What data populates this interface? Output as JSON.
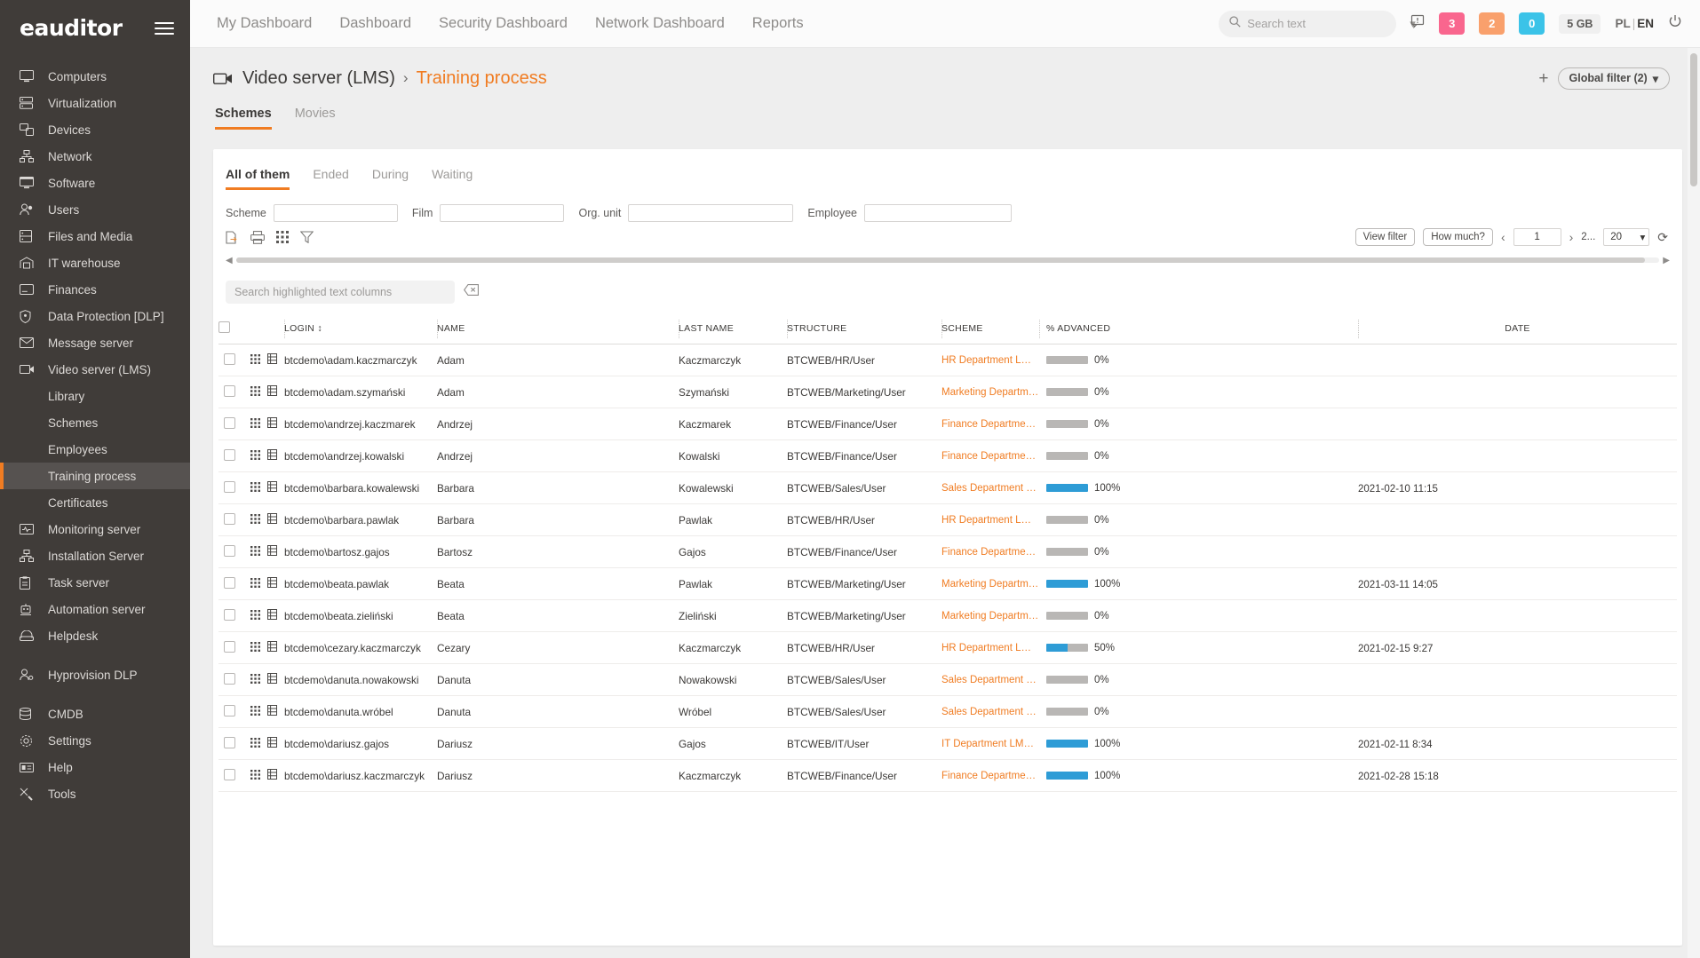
{
  "brand": {
    "logo": "eauditor"
  },
  "sidebar": {
    "items": [
      {
        "label": "Computers",
        "icon": "monitor-icon"
      },
      {
        "label": "Virtualization",
        "icon": "server-stack-icon"
      },
      {
        "label": "Devices",
        "icon": "devices-icon"
      },
      {
        "label": "Network",
        "icon": "network-icon"
      },
      {
        "label": "Software",
        "icon": "monitor-icon"
      },
      {
        "label": "Users",
        "icon": "users-icon"
      },
      {
        "label": "Files and Media",
        "icon": "files-icon"
      },
      {
        "label": "IT warehouse",
        "icon": "warehouse-icon"
      },
      {
        "label": "Finances",
        "icon": "card-icon"
      },
      {
        "label": "Data Protection [DLP]",
        "icon": "shield-icon"
      },
      {
        "label": "Message server",
        "icon": "envelope-icon"
      },
      {
        "label": "Video server (LMS)",
        "icon": "video-camera-icon"
      }
    ],
    "subitems": [
      {
        "label": "Library",
        "active": false
      },
      {
        "label": "Schemes",
        "active": false
      },
      {
        "label": "Employees",
        "active": false
      },
      {
        "label": "Training process",
        "active": true
      },
      {
        "label": "Certificates",
        "active": false
      }
    ],
    "items2": [
      {
        "label": "Monitoring server",
        "icon": "monitor-pulse-icon"
      },
      {
        "label": "Installation Server",
        "icon": "network-icon"
      },
      {
        "label": "Task server",
        "icon": "clipboard-icon"
      },
      {
        "label": "Automation server",
        "icon": "robot-icon"
      },
      {
        "label": "Helpdesk",
        "icon": "helpdesk-icon"
      }
    ],
    "items3": [
      {
        "label": "Hyprovision DLP",
        "icon": "user-lock-icon"
      }
    ],
    "items4": [
      {
        "label": "CMDB",
        "icon": "database-icon"
      },
      {
        "label": "Settings",
        "icon": "gear-icon"
      },
      {
        "label": "Help",
        "icon": "help-card-icon"
      },
      {
        "label": "Tools",
        "icon": "tools-icon"
      }
    ]
  },
  "topbar": {
    "nav": [
      {
        "label": "My Dashboard"
      },
      {
        "label": "Dashboard"
      },
      {
        "label": "Security Dashboard"
      },
      {
        "label": "Network Dashboard"
      },
      {
        "label": "Reports"
      }
    ],
    "search_placeholder": "Search text",
    "search_value": "",
    "badges": [
      {
        "value": "3",
        "color": "#f9668e"
      },
      {
        "value": "2",
        "color": "#f9a06c"
      },
      {
        "value": "0",
        "color": "#3bc3e8"
      }
    ],
    "storage": "5 GB",
    "lang_left": "PL",
    "lang_sep": "|",
    "lang_right": "EN"
  },
  "breadcrumb": {
    "parent": "Video server (LMS)",
    "separator": "›",
    "current": "Training process"
  },
  "global_filter": {
    "plus": "+",
    "label": "Global filter (2)",
    "chevron": "⌄"
  },
  "tabs_primary": [
    {
      "label": "Schemes",
      "active": true
    },
    {
      "label": "Movies",
      "active": false
    }
  ],
  "tabs_secondary": [
    {
      "label": "All of them",
      "active": true
    },
    {
      "label": "Ended",
      "active": false
    },
    {
      "label": "During",
      "active": false
    },
    {
      "label": "Waiting",
      "active": false
    }
  ],
  "filters": [
    {
      "label": "Scheme",
      "value": ""
    },
    {
      "label": "Film",
      "value": ""
    },
    {
      "label": "Org. unit",
      "value": ""
    },
    {
      "label": "Employee",
      "value": ""
    }
  ],
  "toolbar": {
    "icons": [
      {
        "name": "export-icon"
      },
      {
        "name": "print-icon"
      },
      {
        "name": "grid-icon"
      },
      {
        "name": "filter-icon"
      }
    ],
    "view_filter_label": "View filter",
    "how_much_label": "How much?",
    "prev": "‹",
    "page_value": "1",
    "next": "›",
    "total_pages": "2...",
    "page_size": "20",
    "refresh": "⟳"
  },
  "highlight_search": {
    "placeholder": "Search highlighted text columns",
    "value": "",
    "clear_icon": "clear-icon"
  },
  "table": {
    "columns": [
      "LOGIN",
      "NAME",
      "LAST NAME",
      "STRUCTURE",
      "SCHEME",
      "% ADVANCED",
      "DATE"
    ],
    "sort_column": "LOGIN",
    "sort_glyph": "↕",
    "rows": [
      {
        "login": "btcdemo\\adam.kaczmarczyk",
        "name": "Adam",
        "last_name": "Kaczmarczyk",
        "structure": "BTCWEB/HR/User",
        "scheme": "HR Department LMS Scheme",
        "percent": 0,
        "percent_label": "0%",
        "date": ""
      },
      {
        "login": "btcdemo\\adam.szymański",
        "name": "Adam",
        "last_name": "Szymański",
        "structure": "BTCWEB/Marketing/User",
        "scheme": "Marketing Department LMS Sche…",
        "percent": 0,
        "percent_label": "0%",
        "date": ""
      },
      {
        "login": "btcdemo\\andrzej.kaczmarek",
        "name": "Andrzej",
        "last_name": "Kaczmarek",
        "structure": "BTCWEB/Finance/User",
        "scheme": "Finance Department LMS Scheme",
        "percent": 0,
        "percent_label": "0%",
        "date": ""
      },
      {
        "login": "btcdemo\\andrzej.kowalski",
        "name": "Andrzej",
        "last_name": "Kowalski",
        "structure": "BTCWEB/Finance/User",
        "scheme": "Finance Department LMS Scheme",
        "percent": 0,
        "percent_label": "0%",
        "date": ""
      },
      {
        "login": "btcdemo\\barbara.kowalewski",
        "name": "Barbara",
        "last_name": "Kowalewski",
        "structure": "BTCWEB/Sales/User",
        "scheme": "Sales Department LMS Scheme",
        "percent": 100,
        "percent_label": "100%",
        "date": "2021-02-10 11:15"
      },
      {
        "login": "btcdemo\\barbara.pawlak",
        "name": "Barbara",
        "last_name": "Pawlak",
        "structure": "BTCWEB/HR/User",
        "scheme": "HR Department LMS Scheme",
        "percent": 0,
        "percent_label": "0%",
        "date": ""
      },
      {
        "login": "btcdemo\\bartosz.gajos",
        "name": "Bartosz",
        "last_name": "Gajos",
        "structure": "BTCWEB/Finance/User",
        "scheme": "Finance Department LMS Scheme",
        "percent": 0,
        "percent_label": "0%",
        "date": ""
      },
      {
        "login": "btcdemo\\beata.pawlak",
        "name": "Beata",
        "last_name": "Pawlak",
        "structure": "BTCWEB/Marketing/User",
        "scheme": "Marketing Department LMS Sche…",
        "percent": 100,
        "percent_label": "100%",
        "date": "2021-03-11 14:05"
      },
      {
        "login": "btcdemo\\beata.zieliński",
        "name": "Beata",
        "last_name": "Zieliński",
        "structure": "BTCWEB/Marketing/User",
        "scheme": "Marketing Department LMS Sche…",
        "percent": 0,
        "percent_label": "0%",
        "date": ""
      },
      {
        "login": "btcdemo\\cezary.kaczmarczyk",
        "name": "Cezary",
        "last_name": "Kaczmarczyk",
        "structure": "BTCWEB/HR/User",
        "scheme": "HR Department LMS Scheme",
        "percent": 50,
        "percent_label": "50%",
        "date": "2021-02-15 9:27"
      },
      {
        "login": "btcdemo\\danuta.nowakowski",
        "name": "Danuta",
        "last_name": "Nowakowski",
        "structure": "BTCWEB/Sales/User",
        "scheme": "Sales Department LMS Scheme",
        "percent": 0,
        "percent_label": "0%",
        "date": ""
      },
      {
        "login": "btcdemo\\danuta.wróbel",
        "name": "Danuta",
        "last_name": "Wróbel",
        "structure": "BTCWEB/Sales/User",
        "scheme": "Sales Department LMS Scheme",
        "percent": 0,
        "percent_label": "0%",
        "date": ""
      },
      {
        "login": "btcdemo\\dariusz.gajos",
        "name": "Dariusz",
        "last_name": "Gajos",
        "structure": "BTCWEB/IT/User",
        "scheme": "IT Department LMS Scheme",
        "percent": 100,
        "percent_label": "100%",
        "date": "2021-02-11 8:34"
      },
      {
        "login": "btcdemo\\dariusz.kaczmarczyk",
        "name": "Dariusz",
        "last_name": "Kaczmarczyk",
        "structure": "BTCWEB/Finance/User",
        "scheme": "Finance Department LMS Scheme",
        "percent": 100,
        "percent_label": "100%",
        "date": "2021-02-28 15:18"
      }
    ]
  },
  "colors": {
    "accent": "#f07c22",
    "sidebar_bg": "#403c39",
    "progress": "#2e9cd6",
    "progress_track": "#b9b7b5"
  }
}
